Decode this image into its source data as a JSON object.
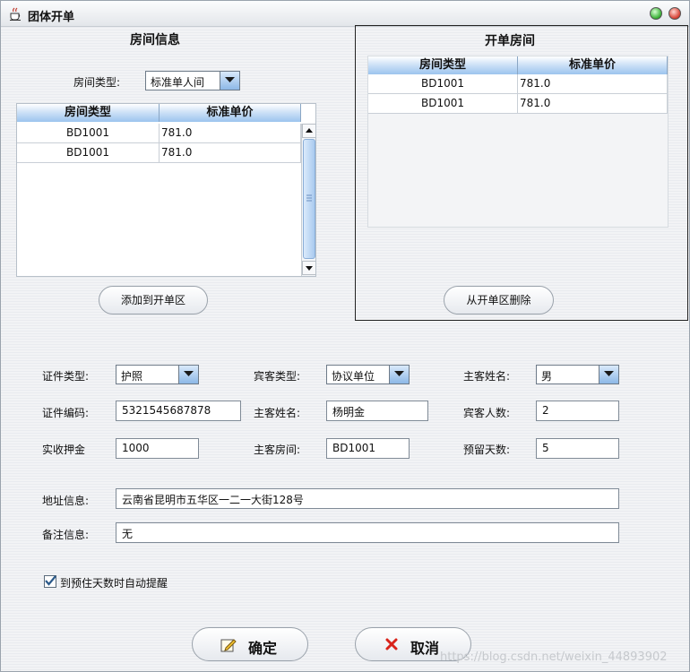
{
  "window": {
    "title": "团体开单"
  },
  "room_info": {
    "title": "房间信息",
    "type_label": "房间类型:",
    "type_value": "标准单人间",
    "columns": [
      "房间类型",
      "标准单价"
    ],
    "rows": [
      [
        "BD1001",
        "781.0"
      ],
      [
        "BD1001",
        "781.0"
      ]
    ],
    "add_button": "添加到开单区"
  },
  "open_rooms": {
    "title": "开单房间",
    "columns": [
      "房间类型",
      "标准单价"
    ],
    "rows": [
      [
        "BD1001",
        "781.0"
      ],
      [
        "BD1001",
        "781.0"
      ]
    ],
    "remove_button": "从开单区删除"
  },
  "form": {
    "id_type_label": "证件类型:",
    "id_type_value": "护照",
    "guest_type_label": "宾客类型:",
    "guest_type_value": "协议单位",
    "main_name_label": "主客姓名:",
    "gender_value": "男",
    "id_number_label": "证件编码:",
    "id_number_value": "5321545687878",
    "main_name_label2": "主客姓名:",
    "main_name_value": "杨明金",
    "guest_count_label": "宾客人数:",
    "guest_count_value": "2",
    "deposit_label": "实收押金",
    "deposit_value": "1000",
    "main_room_label": "主客房间:",
    "main_room_value": "BD1001",
    "reserve_days_label": "预留天数:",
    "reserve_days_value": "5",
    "address_label": "地址信息:",
    "address_value": "云南省昆明市五华区一二一大街128号",
    "remark_label": "备注信息:",
    "remark_value": "无",
    "auto_remind_label": "到预住天数时自动提醒",
    "auto_remind_checked": true
  },
  "actions": {
    "ok": "确定",
    "cancel": "取消"
  },
  "watermark": "https://blog.csdn.net/weixin_44893902",
  "colors": {
    "header_blue": "#9cc4ee",
    "accent_green": "#3eb33a",
    "accent_red": "#d9473a"
  }
}
